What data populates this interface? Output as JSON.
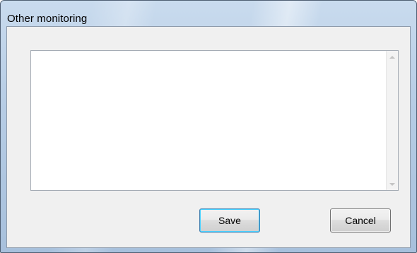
{
  "window": {
    "title": "Other monitoring"
  },
  "textarea": {
    "value": ""
  },
  "buttons": {
    "save_label": "Save",
    "cancel_label": "Cancel"
  },
  "colors": {
    "frame": "#b7cde5",
    "client_background": "#f0f0f0",
    "default_button_border": "#3c7fb1"
  }
}
